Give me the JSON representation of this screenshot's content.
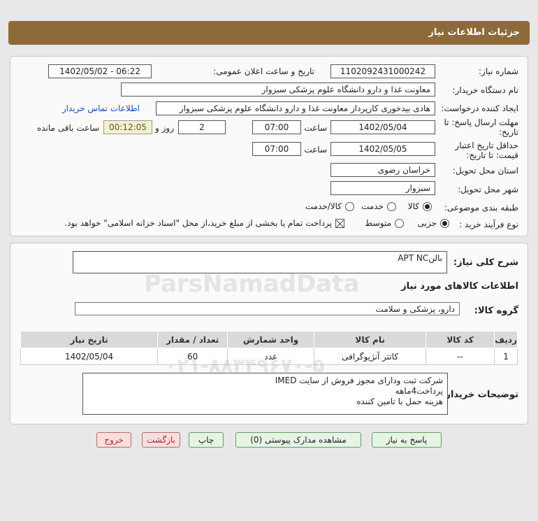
{
  "header": {
    "title": "جزئیات اطلاعات نیاز"
  },
  "fields": {
    "need_number_label": "شماره نیاز:",
    "need_number": "1102092431000242",
    "announce_label": "تاریخ و ساعت اعلان عمومی:",
    "announce_value": "1402/05/02 - 06:22",
    "buyer_org_label": "نام دستگاه خریدار:",
    "buyer_org": "معاونت غذا و دارو   دانشگاه علوم پزشکی سبزوار",
    "creator_label": "ایجاد کننده درخواست:",
    "creator": "هادی بیدخوری کارپرداز معاونت غذا و دارو   دانشگاه علوم پزشکی سبزوار",
    "contact_link": "اطلاعات تماس خریدار",
    "deadline_label_1": "مهلت ارسال پاسخ: تا",
    "deadline_label_2": "تاریخ:",
    "deadline_date": "1402/05/04",
    "time_label": "ساعت",
    "deadline_time": "07:00",
    "days": "2",
    "days_label": "روز و",
    "remaining": "00:12:05",
    "remaining_label": "ساعت باقی مانده",
    "validity_label_1": "حداقل تاریخ اعتبار",
    "validity_label_2": "قیمت: تا تاریخ:",
    "validity_date": "1402/05/05",
    "validity_time": "07:00",
    "province_label": "استان محل تحویل:",
    "province": "خراسان رضوی",
    "city_label": "شهر محل تحویل:",
    "city": "سبزوار",
    "category_label": "طبقه بندی موضوعی:",
    "category_options": [
      "کالا",
      "خدمت",
      "کالا/خدمت"
    ],
    "process_label": "نوع فرآیند خرید :",
    "process_options": [
      "جزیی",
      "متوسط"
    ],
    "payment_note": "پرداخت تمام یا بخشی از مبلغ خرید،از محل \"اسناد خزانه اسلامی\" خواهد بود."
  },
  "summary": {
    "general_desc_label": "شرح کلی نیاز:",
    "general_desc": "بالنAPT NC",
    "goods_info_title": "اطلاعات کالاهای مورد نیاز",
    "goods_group_label": "گروه کالا:",
    "goods_group": "دارو، پزشکی و سلامت"
  },
  "table": {
    "headers": [
      "ردیف",
      "کد کالا",
      "نام کالا",
      "واحد شمارش",
      "تعداد / مقدار",
      "تاریخ نیاز"
    ],
    "rows": [
      [
        "1",
        "--",
        "کاتتر آنژیوگرافی",
        "عدد",
        "60",
        "1402/05/04"
      ]
    ]
  },
  "buyer_notes": {
    "label": "توضیحات خریدار:",
    "lines": [
      "شرکت ثبت ودارای مجوز فروش از سایت IMED",
      "پرداخت4ماهه",
      "هزینه حمل با تامین کننده"
    ]
  },
  "buttons": {
    "reply": "پاسخ به نیاز",
    "attachments": "مشاهده مدارک پیوستی (0)",
    "print": "چاپ",
    "back": "بازگشت",
    "exit": "خروج"
  },
  "watermark": {
    "main": "ParsNamadData",
    "phone": "۰۲۱-۸۸۳۴۹۶۷۰-۵"
  }
}
